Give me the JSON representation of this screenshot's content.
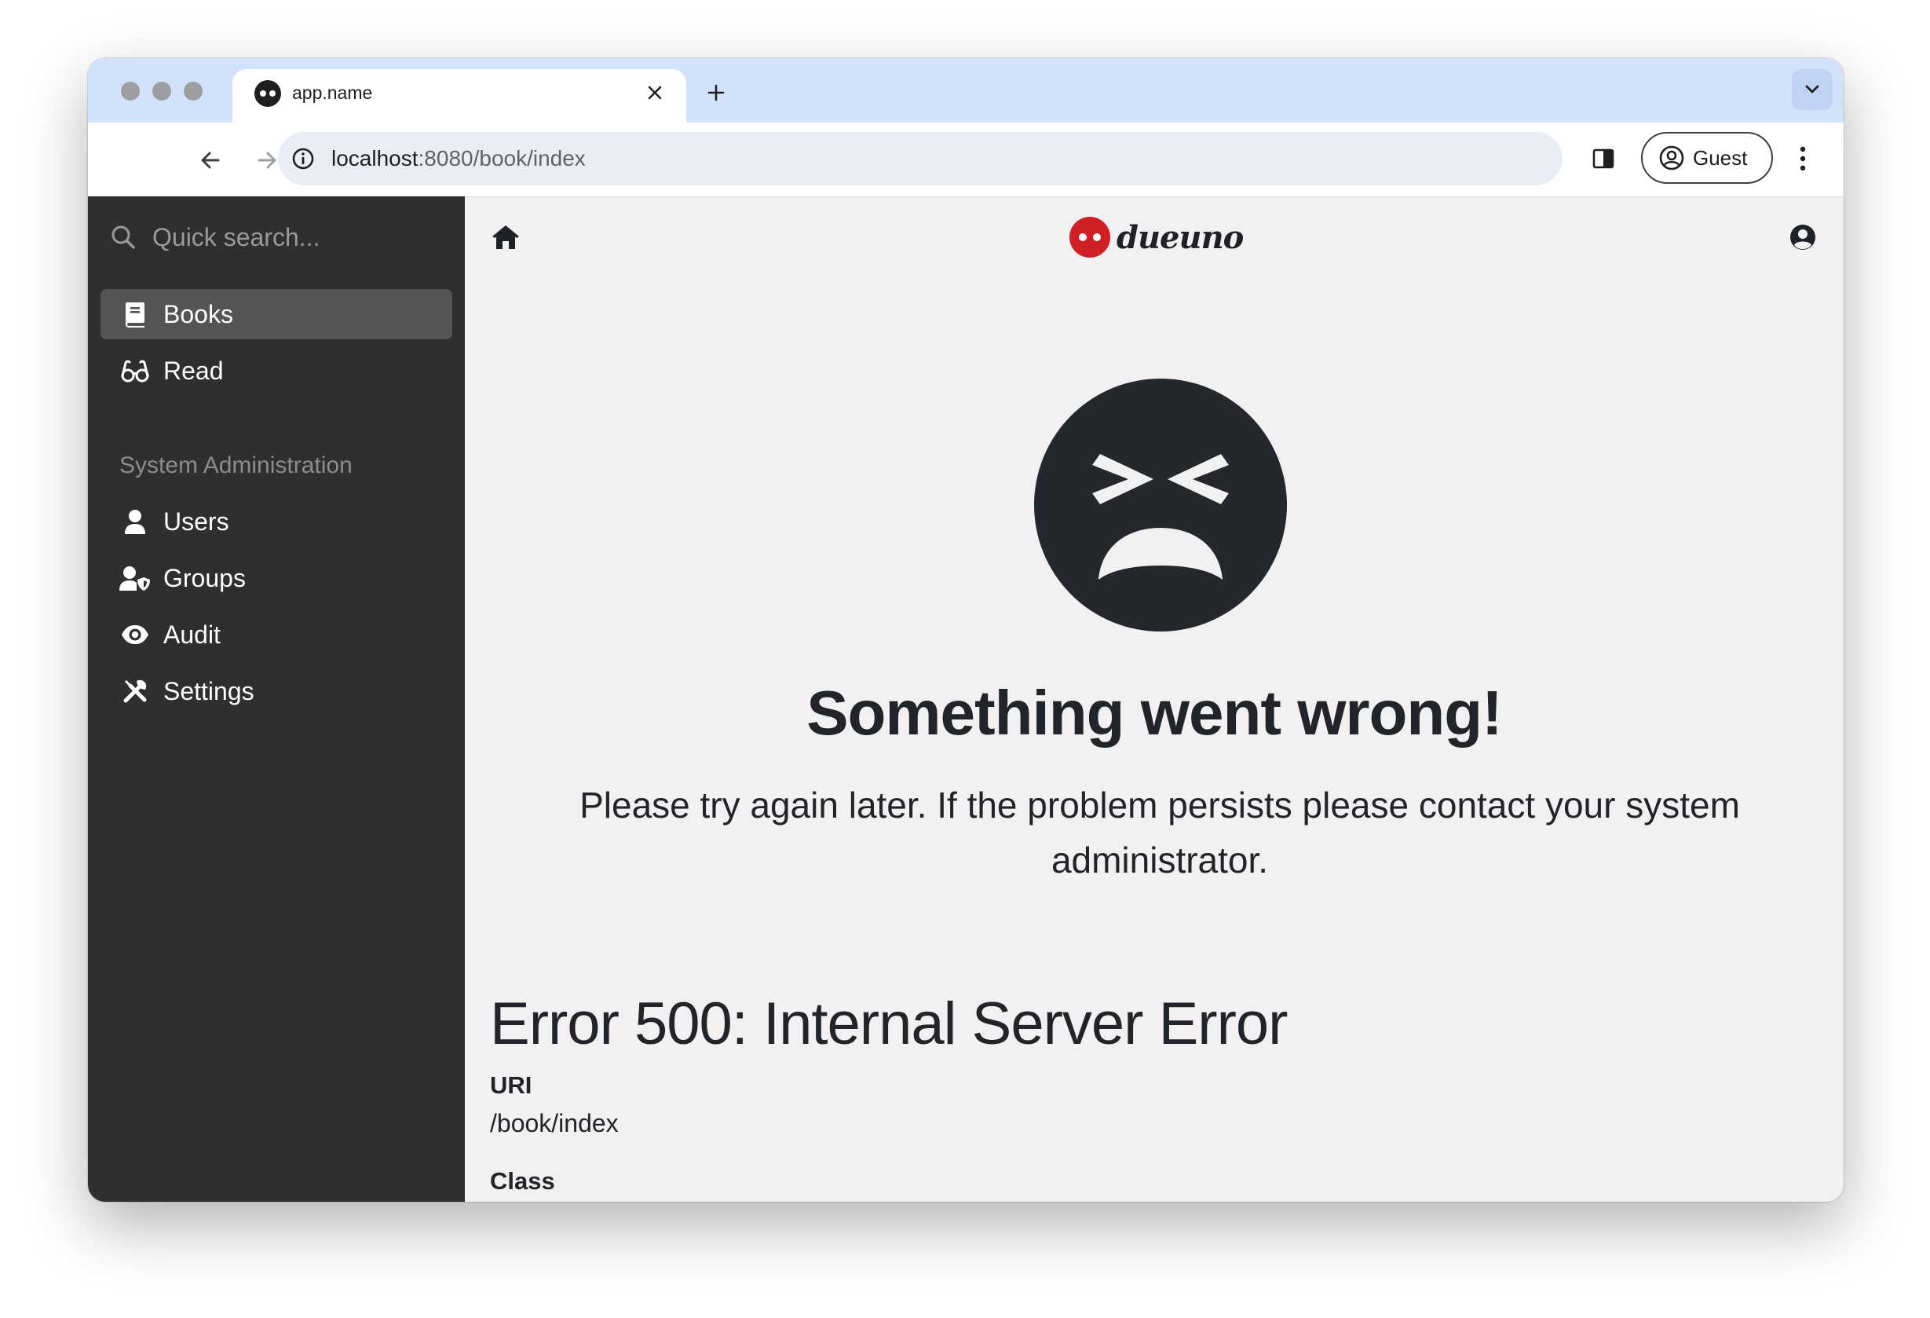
{
  "browser": {
    "tab_title": "app.name",
    "new_tab_symbol": "+",
    "url_host": "localhost",
    "url_port": ":8080",
    "url_path": "/book/index",
    "profile_label": "Guest"
  },
  "sidebar": {
    "search_placeholder": "Quick search...",
    "items": [
      {
        "label": "Books",
        "icon": "book-icon",
        "active": true
      },
      {
        "label": "Read",
        "icon": "glasses-icon",
        "active": false
      }
    ],
    "section_title": "System Administration",
    "admin_items": [
      {
        "label": "Users",
        "icon": "user-icon"
      },
      {
        "label": "Groups",
        "icon": "user-shield-icon"
      },
      {
        "label": "Audit",
        "icon": "eye-icon"
      },
      {
        "label": "Settings",
        "icon": "tools-icon"
      }
    ]
  },
  "header": {
    "brand_name": "dueuno"
  },
  "error": {
    "title": "Something went wrong!",
    "message": "Please try again later. If the problem persists please contact your system administrator.",
    "code_title": "Error 500: Internal Server Error",
    "fields": [
      {
        "label": "URI",
        "value": "/book/index"
      },
      {
        "label": "Class",
        "value": ""
      }
    ]
  },
  "colors": {
    "sidebar_bg": "#2f2f2f",
    "sidebar_active": "#545454",
    "content_bg": "#f2f0f1",
    "brand_red": "#d11f26",
    "tabstrip_bg": "#d3e2fb"
  }
}
